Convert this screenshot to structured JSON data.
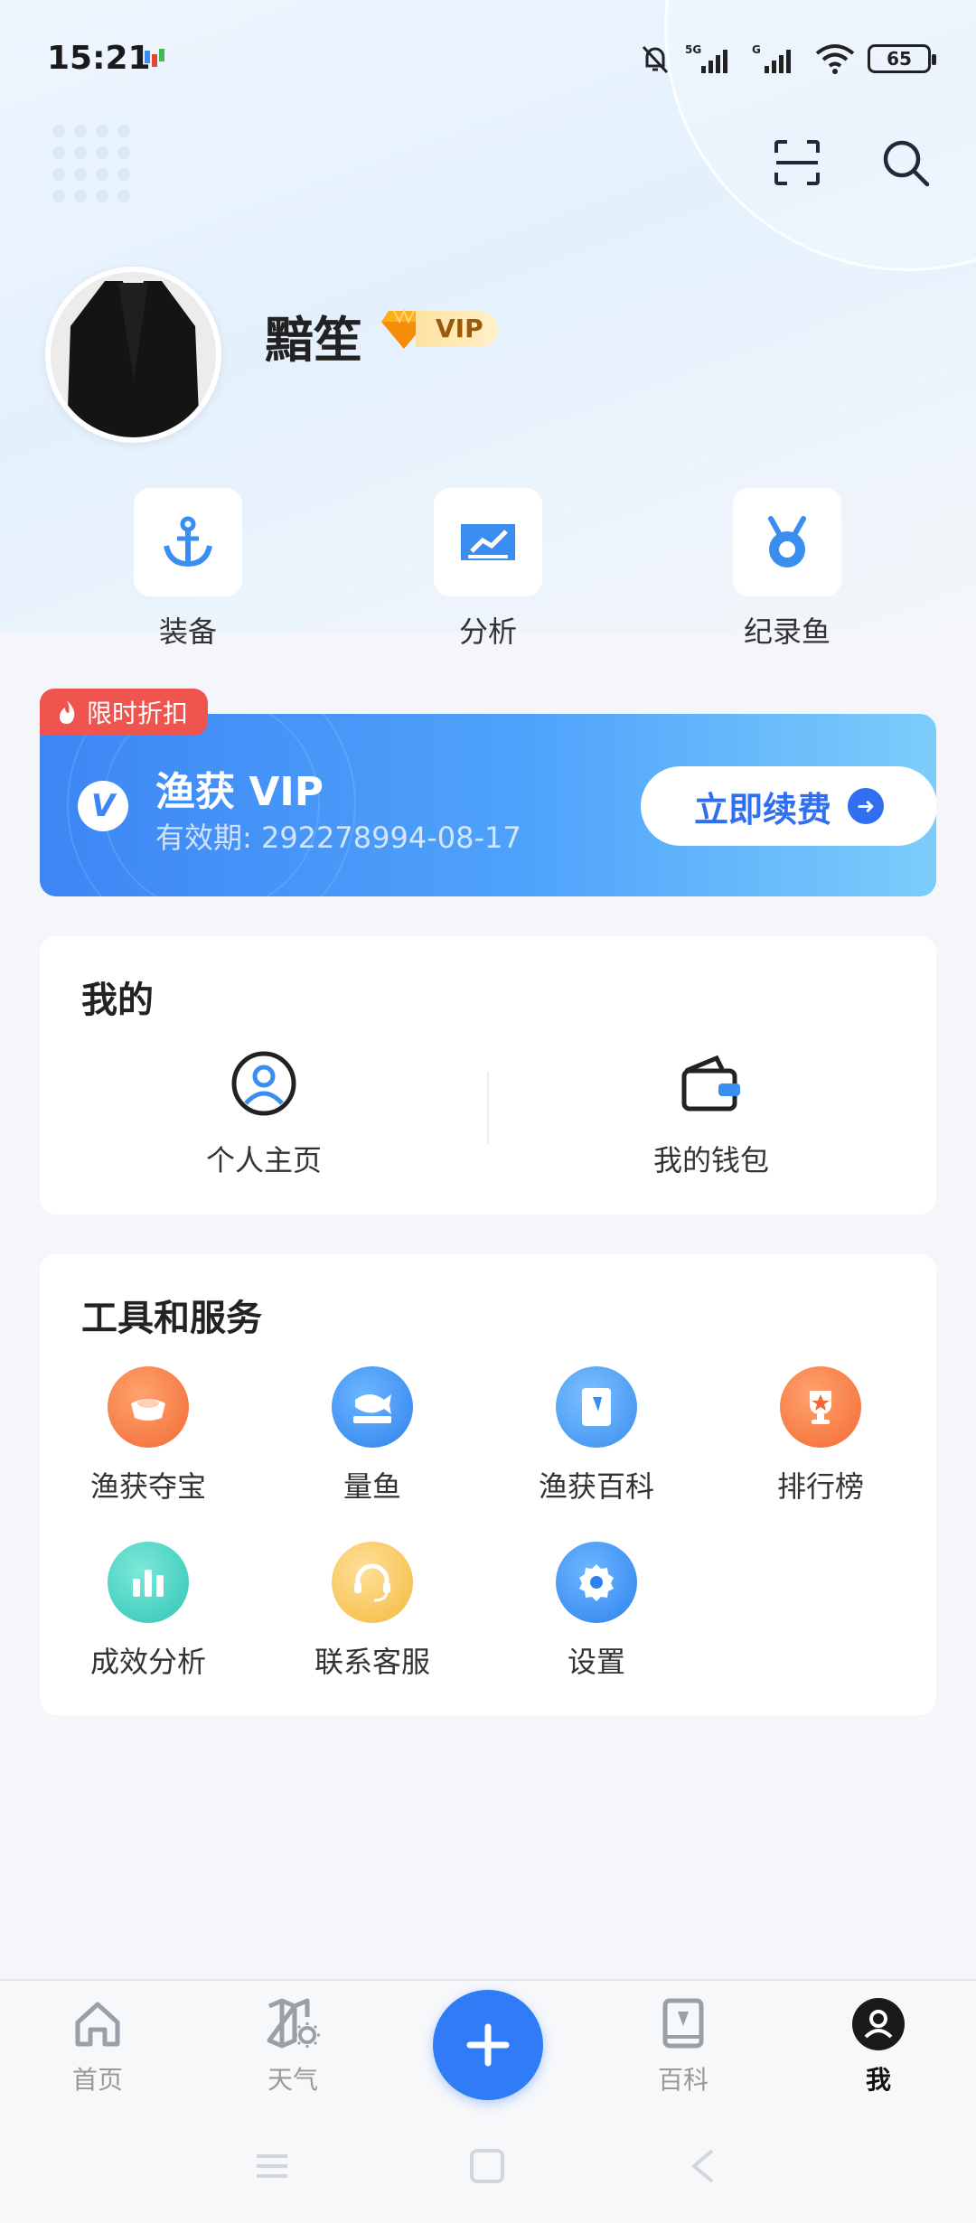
{
  "status_bar": {
    "time": "15:21",
    "battery": "65"
  },
  "profile": {
    "username": "黯笙",
    "vip_label": "VIP"
  },
  "quick_actions": [
    {
      "label": "装备",
      "icon": "anchor-icon"
    },
    {
      "label": "分析",
      "icon": "chart-icon"
    },
    {
      "label": "纪录鱼",
      "icon": "medal-icon"
    }
  ],
  "vip_banner": {
    "tag": "限时折扣",
    "logo": "V",
    "title": "渔获 VIP",
    "expiry": "有效期: 292278994-08-17",
    "button": "立即续费"
  },
  "mine": {
    "title": "我的",
    "items": [
      {
        "label": "个人主页",
        "icon": "user-icon"
      },
      {
        "label": "我的钱包",
        "icon": "wallet-icon"
      }
    ]
  },
  "tools": {
    "title": "工具和服务",
    "items": [
      {
        "label": "渔获夺宝",
        "icon": "treasure-icon",
        "color": "#fa7d45"
      },
      {
        "label": "量鱼",
        "icon": "fish-ruler-icon",
        "color": "#3a96f6"
      },
      {
        "label": "渔获百科",
        "icon": "book-icon",
        "color": "#4aa4f5"
      },
      {
        "label": "排行榜",
        "icon": "trophy-icon",
        "color": "#fa7d45"
      },
      {
        "label": "成效分析",
        "icon": "bar-chart-icon",
        "color": "#39cfc0"
      },
      {
        "label": "联系客服",
        "icon": "headset-icon",
        "color": "#f5c452"
      },
      {
        "label": "设置",
        "icon": "gear-icon",
        "color": "#3a96f6"
      }
    ]
  },
  "tabbar": [
    {
      "label": "首页",
      "icon": "home-icon"
    },
    {
      "label": "天气",
      "icon": "weather-map-icon"
    },
    {
      "label": "",
      "icon": "plus-icon"
    },
    {
      "label": "百科",
      "icon": "encyclopedia-icon"
    },
    {
      "label": "我",
      "icon": "profile-icon"
    }
  ]
}
